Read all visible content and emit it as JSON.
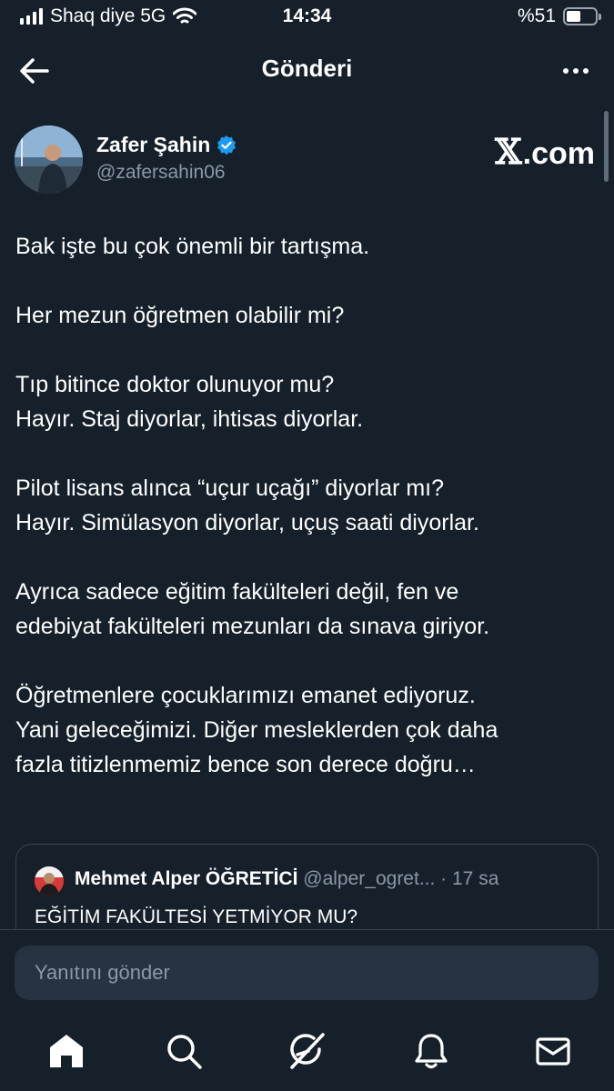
{
  "status_bar": {
    "carrier": "Shaq diye 5G",
    "time": "14:34",
    "battery_text": "%51",
    "battery_level": 0.51
  },
  "header": {
    "title": "Gönderi",
    "back_icon": "arrow-left-icon",
    "more_icon": "more-dots-icon"
  },
  "author": {
    "name": "Zafer Şahin",
    "handle": "@zafersahin06",
    "verified": true,
    "verified_color": "#1d9bf0"
  },
  "watermark": {
    "x_glyph": "𝕏",
    "suffix": ".com"
  },
  "tweet": {
    "paragraphs": [
      "Bak işte bu çok önemli bir tartışma.",
      "Her mezun öğretmen olabilir mi?",
      "Tıp bitince doktor olunuyor mu?\nHayır. Staj diyorlar, ihtisas diyorlar.",
      "Pilot lisans alınca “uçur uçağı” diyorlar mı?\nHayır. Simülasyon diyorlar, uçuş saati diyorlar.",
      "Ayrıca sadece eğitim fakülteleri değil, fen ve\nedebiyat fakülteleri mezunları da sınava giriyor.",
      "Öğretmenlere çocuklarımızı emanet ediyoruz.\nYani geleceğimizi. Diğer mesleklerden çok daha\nfazla titizlenmemiz bence son derece doğru…"
    ]
  },
  "quote": {
    "name": "Mehmet Alper ÖĞRETİCİ",
    "handle": "@alper_ogret...",
    "time": "· 17 sa",
    "text": "EĞİTİM FAKÜLTESİ YETMİYOR MU?"
  },
  "composer": {
    "placeholder": "Yanıtını gönder"
  },
  "tabbar": {
    "items": [
      {
        "icon": "home-icon",
        "active": true
      },
      {
        "icon": "search-icon",
        "active": false
      },
      {
        "icon": "grok-icon",
        "active": false
      },
      {
        "icon": "notifications-bell-icon",
        "active": false
      },
      {
        "icon": "messages-envelope-icon",
        "active": false
      }
    ]
  },
  "colors": {
    "background": "#15202b",
    "secondary_text": "#8b98a5",
    "border": "#38444d",
    "input_bg": "#273340"
  }
}
